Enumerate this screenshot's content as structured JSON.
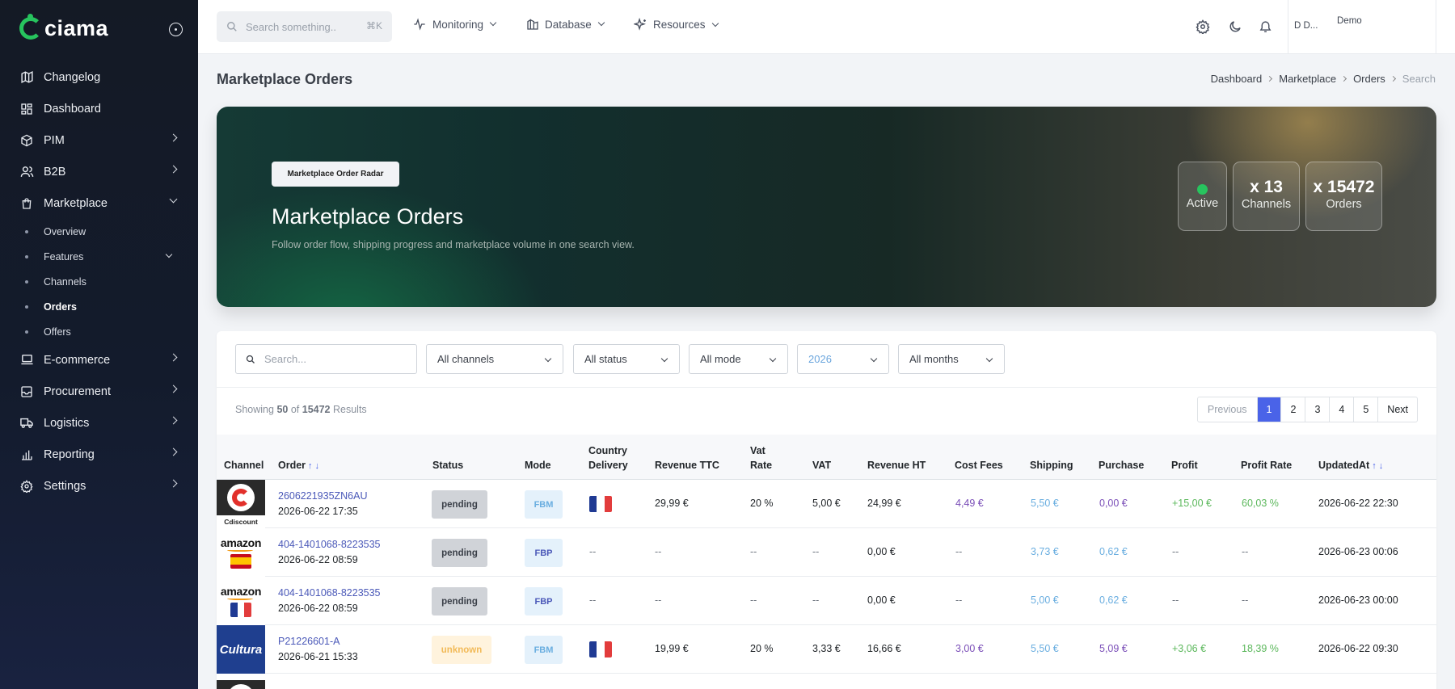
{
  "app": {
    "logo_text": "ciama"
  },
  "sidebar": {
    "items": [
      {
        "label": "Changelog"
      },
      {
        "label": "Dashboard"
      },
      {
        "label": "PIM"
      },
      {
        "label": "B2B"
      },
      {
        "label": "Marketplace"
      },
      {
        "label": "E-commerce"
      },
      {
        "label": "Procurement"
      },
      {
        "label": "Logistics"
      },
      {
        "label": "Reporting"
      },
      {
        "label": "Settings"
      }
    ],
    "marketplace_sub": [
      {
        "label": "Overview"
      },
      {
        "label": "Features"
      },
      {
        "label": "Channels"
      },
      {
        "label": "Orders"
      },
      {
        "label": "Offers"
      }
    ]
  },
  "topbar": {
    "search_placeholder": "Search something..",
    "search_shortcut": "⌘K",
    "menus": [
      {
        "label": "Monitoring"
      },
      {
        "label": "Database"
      },
      {
        "label": "Resources"
      }
    ],
    "user_initials": "D D...",
    "user_name": "Demo"
  },
  "page": {
    "title": "Marketplace Orders",
    "breadcrumb": [
      "Dashboard",
      "Marketplace",
      "Orders",
      "Search"
    ]
  },
  "hero": {
    "badge": "Marketplace Order Radar",
    "title": "Marketplace Orders",
    "subtitle": "Follow order flow, shipping progress and marketplace volume in one search view.",
    "cards": {
      "active": "Active",
      "channels_count": "x 13",
      "channels_label": "Channels",
      "orders_count": "x 15472",
      "orders_label": "Orders"
    },
    "status_color": "#27c45e"
  },
  "filters": {
    "search_placeholder": "Search...",
    "channel": "All channels",
    "status": "All status",
    "mode": "All mode",
    "year": "2026",
    "month": "All months"
  },
  "results": {
    "showing_prefix": "Showing",
    "shown": "50",
    "of": "of",
    "total": "15472",
    "suffix": "Results"
  },
  "pagination": {
    "previous": "Previous",
    "pages": [
      "1",
      "2",
      "3",
      "4",
      "5"
    ],
    "current": "1",
    "next": "Next"
  },
  "table": {
    "columns": {
      "channel": "Channel",
      "order": "Order",
      "status": "Status",
      "mode": "Mode",
      "country_1": "Country",
      "country_2": "Delivery",
      "revenue_ttc": "Revenue TTC",
      "vat_rate_1": "Vat",
      "vat_rate_2": "Rate",
      "vat": "VAT",
      "revenue_ht": "Revenue HT",
      "cost_fees": "Cost Fees",
      "shipping": "Shipping",
      "purchase": "Purchase",
      "profit": "Profit",
      "profit_rate": "Profit Rate",
      "updated_at": "UpdatedAt"
    },
    "rows": [
      {
        "channel_logo": "cdiscount-logo",
        "channel_text": "Cdiscount",
        "order_id": "2606221935ZN6AU",
        "order_date": "2026-06-22 17:35",
        "status": "pending",
        "mode": "FBM",
        "country": "fr-flag",
        "revenue_ttc": "29,99 €",
        "vat_rate": "20 %",
        "vat": "5,00 €",
        "revenue_ht": "24,99 €",
        "cost_fees": "4,49 €",
        "shipping": "5,50 €",
        "purchase": "0,00 €",
        "profit": "+15,00 €",
        "profit_rate": "60,03 %",
        "updated_at": "2026-06-22 22:30"
      },
      {
        "channel_logo": "amazon-es-logo",
        "channel_text": "amazon",
        "order_id": "404-1401068-8223535",
        "order_date": "2026-06-22 08:59",
        "status": "pending",
        "mode": "FBP",
        "country": "--",
        "revenue_ttc": "--",
        "vat_rate": "--",
        "vat": "--",
        "revenue_ht": "0,00 €",
        "cost_fees": "--",
        "shipping": "3,73 €",
        "purchase": "0,62 €",
        "profit": "--",
        "profit_rate": "--",
        "updated_at": "2026-06-23 00:06"
      },
      {
        "channel_logo": "amazon-fr-logo",
        "channel_text": "amazon",
        "order_id": "404-1401068-8223535",
        "order_date": "2026-06-22 08:59",
        "status": "pending",
        "mode": "FBP",
        "country": "--",
        "revenue_ttc": "--",
        "vat_rate": "--",
        "vat": "--",
        "revenue_ht": "0,00 €",
        "cost_fees": "--",
        "shipping": "5,00 €",
        "purchase": "0,62 €",
        "profit": "--",
        "profit_rate": "--",
        "updated_at": "2026-06-23 00:00"
      },
      {
        "channel_logo": "cultura-logo",
        "channel_text": "Cultura",
        "order_id": "P21226601-A",
        "order_date": "2026-06-21 15:33",
        "status": "unknown",
        "mode": "FBM",
        "country": "fr-flag",
        "revenue_ttc": "19,99 €",
        "vat_rate": "20 %",
        "vat": "3,33 €",
        "revenue_ht": "16,66 €",
        "cost_fees": "3,00 €",
        "shipping": "5,50 €",
        "purchase": "5,09 €",
        "profit": "+3,06 €",
        "profit_rate": "18,39 %",
        "updated_at": "2026-06-22 09:30"
      }
    ]
  },
  "colors": {
    "accent": "#4a63e8",
    "link": "#4a58b8",
    "purple": "#7b4fb8",
    "light_blue": "#6aaee0",
    "green": "#5cb85c"
  }
}
